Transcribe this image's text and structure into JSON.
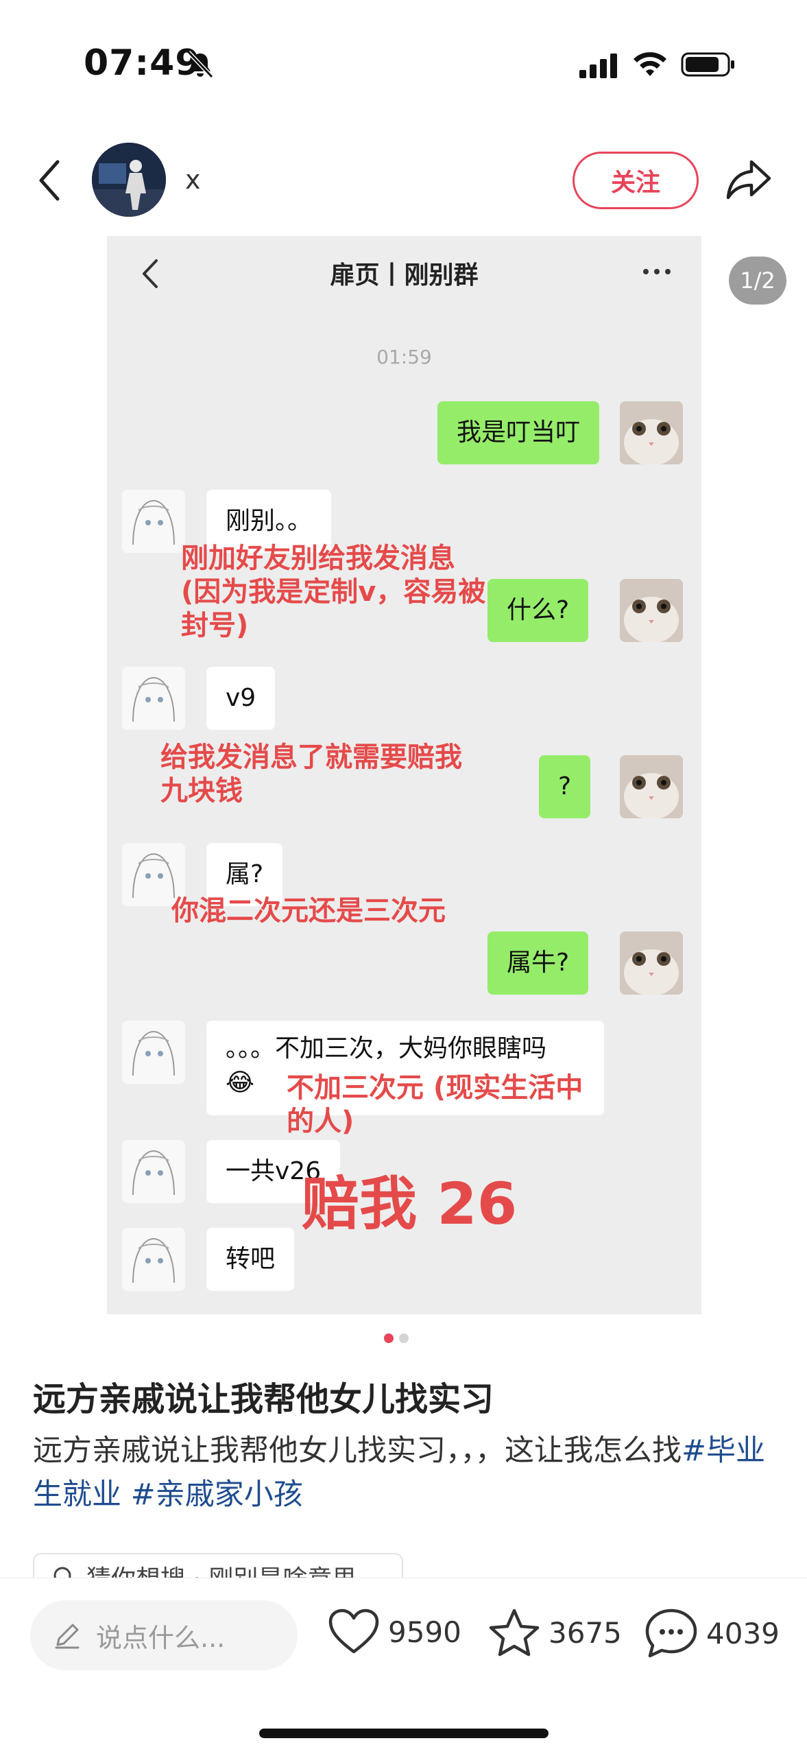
{
  "status_bar": {
    "time": "07:49"
  },
  "header": {
    "author_name": "x",
    "follow_label": "关注"
  },
  "image": {
    "page_indicator": "1/2",
    "chat": {
      "title": "扉页丨刚别群",
      "time": "01:59",
      "messages": [
        {
          "side": "right",
          "text": "我是叮当叮"
        },
        {
          "side": "left",
          "text": "刚别。。"
        },
        {
          "side": "right",
          "text": "什么?"
        },
        {
          "side": "left",
          "text": "v9"
        },
        {
          "side": "right",
          "text": "?"
        },
        {
          "side": "left",
          "text": "属?"
        },
        {
          "side": "right",
          "text": "属牛?"
        },
        {
          "side": "left",
          "text": "。。。不加三次，大妈你眼瞎吗",
          "text2": "😂"
        },
        {
          "side": "left",
          "text": "一共v26"
        },
        {
          "side": "left",
          "text": "转吧"
        }
      ]
    },
    "annotations": [
      {
        "lines": [
          "刚加好友别给我发消息",
          "(因为我是定制v，容易被",
          "封号)"
        ]
      },
      {
        "lines": [
          "给我发消息了就需要赔我",
          "九块钱"
        ]
      },
      {
        "lines": [
          "你混二次元还是三次元"
        ]
      },
      {
        "lines": [
          "不加三次元 (现实生活中",
          "的人)"
        ]
      },
      {
        "lines": [
          "赔我 26"
        ]
      }
    ]
  },
  "post": {
    "title": "远方亲戚说让我帮他女儿找实习",
    "body_text": "远方亲戚说让我帮他女儿找实习，，，这让我怎么找",
    "hashtags": [
      "#毕业生就业",
      "#亲戚家小孩"
    ],
    "guess_chip": "猜你想搜 · 刚别是啥意思"
  },
  "bottom_bar": {
    "comment_placeholder": "说点什么...",
    "like_count": "9590",
    "collect_count": "3675",
    "comment_count": "4039"
  },
  "colors": {
    "accent": "#e8445a",
    "bubble_green": "#95ec69",
    "annotation_red": "#e54a4a",
    "hashtag_blue": "#1f4c8f"
  },
  "icons": [
    "bell-slash-icon",
    "signal-icon",
    "wifi-icon",
    "battery-icon",
    "back-icon",
    "share-icon",
    "more-icon",
    "search-icon",
    "pencil-icon",
    "heart-icon",
    "star-icon",
    "comment-icon"
  ]
}
